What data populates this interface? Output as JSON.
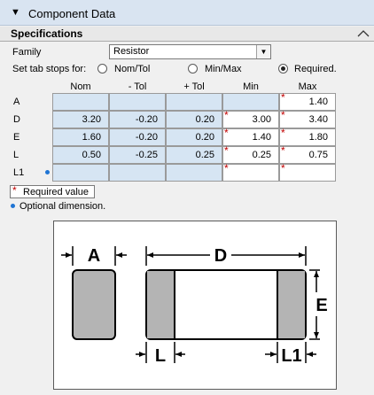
{
  "panel": {
    "title": "Component Data",
    "toggle_icon": "triangle-down-icon"
  },
  "section": {
    "title": "Specifications",
    "collapse_icon": "chevron-up-icon"
  },
  "family": {
    "label": "Family",
    "value": "Resistor"
  },
  "tab_stops": {
    "label": "Set tab stops for:",
    "options": [
      {
        "label": "Nom/Tol",
        "selected": false
      },
      {
        "label": "Min/Max",
        "selected": false
      },
      {
        "label": "Required.",
        "selected": true
      }
    ]
  },
  "table": {
    "columns": [
      "Nom",
      "- Tol",
      "+ Tol",
      "Min",
      "Max"
    ],
    "rows": [
      {
        "label": "A",
        "cells": [
          "",
          "",
          "",
          "",
          "1.40"
        ]
      },
      {
        "label": "D",
        "cells": [
          "3.20",
          "-0.20",
          "0.20",
          "3.00",
          "3.40"
        ]
      },
      {
        "label": "E",
        "cells": [
          "1.60",
          "-0.20",
          "0.20",
          "1.40",
          "1.80"
        ]
      },
      {
        "label": "L",
        "cells": [
          "0.50",
          "-0.25",
          "0.25",
          "0.25",
          "0.75"
        ]
      },
      {
        "label": "L1",
        "cells": [
          "",
          "",
          "",
          "",
          ""
        ],
        "optional": true
      }
    ]
  },
  "legend": {
    "required": "Required value",
    "optional": "Optional dimension."
  },
  "diagram": {
    "labels": {
      "A": "A",
      "D": "D",
      "E": "E",
      "L": "L",
      "L1": "L1"
    },
    "colors": {
      "body": "#ffffff",
      "terminal": "#b4b4b4",
      "outline": "#000000"
    }
  },
  "colors": {
    "required_star": "#c00000",
    "optional_dot": "#1f74d4",
    "input_blue": "#d6e5f3"
  }
}
